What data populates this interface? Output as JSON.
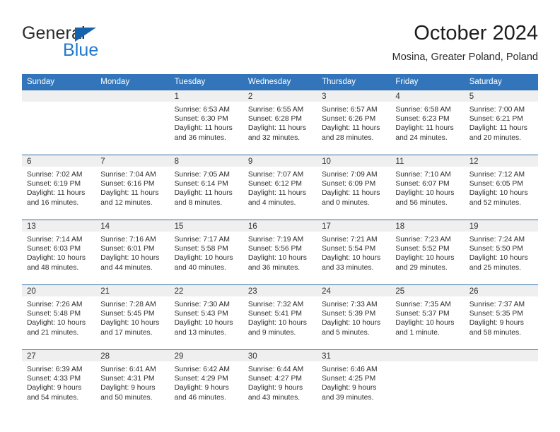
{
  "brand": {
    "name_part1": "General",
    "name_part2": "Blue",
    "accent_color": "#2079cf",
    "triangle_color": "#1463ac"
  },
  "header": {
    "title": "October 2024",
    "subtitle": "Mosina, Greater Poland, Poland",
    "header_bg_color": "#3275ba",
    "row_divider_color": "#2c6ba8",
    "daybar_bg_color": "#efefef"
  },
  "weekday_headers": [
    "Sunday",
    "Monday",
    "Tuesday",
    "Wednesday",
    "Thursday",
    "Friday",
    "Saturday"
  ],
  "weeks": [
    [
      {
        "day": "",
        "empty": true,
        "sunrise": "",
        "sunset": "",
        "daylight_l1": "",
        "daylight_l2": ""
      },
      {
        "day": "",
        "empty": true,
        "sunrise": "",
        "sunset": "",
        "daylight_l1": "",
        "daylight_l2": ""
      },
      {
        "day": "1",
        "empty": false,
        "sunrise": "Sunrise: 6:53 AM",
        "sunset": "Sunset: 6:30 PM",
        "daylight_l1": "Daylight: 11 hours",
        "daylight_l2": "and 36 minutes."
      },
      {
        "day": "2",
        "empty": false,
        "sunrise": "Sunrise: 6:55 AM",
        "sunset": "Sunset: 6:28 PM",
        "daylight_l1": "Daylight: 11 hours",
        "daylight_l2": "and 32 minutes."
      },
      {
        "day": "3",
        "empty": false,
        "sunrise": "Sunrise: 6:57 AM",
        "sunset": "Sunset: 6:26 PM",
        "daylight_l1": "Daylight: 11 hours",
        "daylight_l2": "and 28 minutes."
      },
      {
        "day": "4",
        "empty": false,
        "sunrise": "Sunrise: 6:58 AM",
        "sunset": "Sunset: 6:23 PM",
        "daylight_l1": "Daylight: 11 hours",
        "daylight_l2": "and 24 minutes."
      },
      {
        "day": "5",
        "empty": false,
        "sunrise": "Sunrise: 7:00 AM",
        "sunset": "Sunset: 6:21 PM",
        "daylight_l1": "Daylight: 11 hours",
        "daylight_l2": "and 20 minutes."
      }
    ],
    [
      {
        "day": "6",
        "empty": false,
        "sunrise": "Sunrise: 7:02 AM",
        "sunset": "Sunset: 6:19 PM",
        "daylight_l1": "Daylight: 11 hours",
        "daylight_l2": "and 16 minutes."
      },
      {
        "day": "7",
        "empty": false,
        "sunrise": "Sunrise: 7:04 AM",
        "sunset": "Sunset: 6:16 PM",
        "daylight_l1": "Daylight: 11 hours",
        "daylight_l2": "and 12 minutes."
      },
      {
        "day": "8",
        "empty": false,
        "sunrise": "Sunrise: 7:05 AM",
        "sunset": "Sunset: 6:14 PM",
        "daylight_l1": "Daylight: 11 hours",
        "daylight_l2": "and 8 minutes."
      },
      {
        "day": "9",
        "empty": false,
        "sunrise": "Sunrise: 7:07 AM",
        "sunset": "Sunset: 6:12 PM",
        "daylight_l1": "Daylight: 11 hours",
        "daylight_l2": "and 4 minutes."
      },
      {
        "day": "10",
        "empty": false,
        "sunrise": "Sunrise: 7:09 AM",
        "sunset": "Sunset: 6:09 PM",
        "daylight_l1": "Daylight: 11 hours",
        "daylight_l2": "and 0 minutes."
      },
      {
        "day": "11",
        "empty": false,
        "sunrise": "Sunrise: 7:10 AM",
        "sunset": "Sunset: 6:07 PM",
        "daylight_l1": "Daylight: 10 hours",
        "daylight_l2": "and 56 minutes."
      },
      {
        "day": "12",
        "empty": false,
        "sunrise": "Sunrise: 7:12 AM",
        "sunset": "Sunset: 6:05 PM",
        "daylight_l1": "Daylight: 10 hours",
        "daylight_l2": "and 52 minutes."
      }
    ],
    [
      {
        "day": "13",
        "empty": false,
        "sunrise": "Sunrise: 7:14 AM",
        "sunset": "Sunset: 6:03 PM",
        "daylight_l1": "Daylight: 10 hours",
        "daylight_l2": "and 48 minutes."
      },
      {
        "day": "14",
        "empty": false,
        "sunrise": "Sunrise: 7:16 AM",
        "sunset": "Sunset: 6:01 PM",
        "daylight_l1": "Daylight: 10 hours",
        "daylight_l2": "and 44 minutes."
      },
      {
        "day": "15",
        "empty": false,
        "sunrise": "Sunrise: 7:17 AM",
        "sunset": "Sunset: 5:58 PM",
        "daylight_l1": "Daylight: 10 hours",
        "daylight_l2": "and 40 minutes."
      },
      {
        "day": "16",
        "empty": false,
        "sunrise": "Sunrise: 7:19 AM",
        "sunset": "Sunset: 5:56 PM",
        "daylight_l1": "Daylight: 10 hours",
        "daylight_l2": "and 36 minutes."
      },
      {
        "day": "17",
        "empty": false,
        "sunrise": "Sunrise: 7:21 AM",
        "sunset": "Sunset: 5:54 PM",
        "daylight_l1": "Daylight: 10 hours",
        "daylight_l2": "and 33 minutes."
      },
      {
        "day": "18",
        "empty": false,
        "sunrise": "Sunrise: 7:23 AM",
        "sunset": "Sunset: 5:52 PM",
        "daylight_l1": "Daylight: 10 hours",
        "daylight_l2": "and 29 minutes."
      },
      {
        "day": "19",
        "empty": false,
        "sunrise": "Sunrise: 7:24 AM",
        "sunset": "Sunset: 5:50 PM",
        "daylight_l1": "Daylight: 10 hours",
        "daylight_l2": "and 25 minutes."
      }
    ],
    [
      {
        "day": "20",
        "empty": false,
        "sunrise": "Sunrise: 7:26 AM",
        "sunset": "Sunset: 5:48 PM",
        "daylight_l1": "Daylight: 10 hours",
        "daylight_l2": "and 21 minutes."
      },
      {
        "day": "21",
        "empty": false,
        "sunrise": "Sunrise: 7:28 AM",
        "sunset": "Sunset: 5:45 PM",
        "daylight_l1": "Daylight: 10 hours",
        "daylight_l2": "and 17 minutes."
      },
      {
        "day": "22",
        "empty": false,
        "sunrise": "Sunrise: 7:30 AM",
        "sunset": "Sunset: 5:43 PM",
        "daylight_l1": "Daylight: 10 hours",
        "daylight_l2": "and 13 minutes."
      },
      {
        "day": "23",
        "empty": false,
        "sunrise": "Sunrise: 7:32 AM",
        "sunset": "Sunset: 5:41 PM",
        "daylight_l1": "Daylight: 10 hours",
        "daylight_l2": "and 9 minutes."
      },
      {
        "day": "24",
        "empty": false,
        "sunrise": "Sunrise: 7:33 AM",
        "sunset": "Sunset: 5:39 PM",
        "daylight_l1": "Daylight: 10 hours",
        "daylight_l2": "and 5 minutes."
      },
      {
        "day": "25",
        "empty": false,
        "sunrise": "Sunrise: 7:35 AM",
        "sunset": "Sunset: 5:37 PM",
        "daylight_l1": "Daylight: 10 hours",
        "daylight_l2": "and 1 minute."
      },
      {
        "day": "26",
        "empty": false,
        "sunrise": "Sunrise: 7:37 AM",
        "sunset": "Sunset: 5:35 PM",
        "daylight_l1": "Daylight: 9 hours",
        "daylight_l2": "and 58 minutes."
      }
    ],
    [
      {
        "day": "27",
        "empty": false,
        "sunrise": "Sunrise: 6:39 AM",
        "sunset": "Sunset: 4:33 PM",
        "daylight_l1": "Daylight: 9 hours",
        "daylight_l2": "and 54 minutes."
      },
      {
        "day": "28",
        "empty": false,
        "sunrise": "Sunrise: 6:41 AM",
        "sunset": "Sunset: 4:31 PM",
        "daylight_l1": "Daylight: 9 hours",
        "daylight_l2": "and 50 minutes."
      },
      {
        "day": "29",
        "empty": false,
        "sunrise": "Sunrise: 6:42 AM",
        "sunset": "Sunset: 4:29 PM",
        "daylight_l1": "Daylight: 9 hours",
        "daylight_l2": "and 46 minutes."
      },
      {
        "day": "30",
        "empty": false,
        "sunrise": "Sunrise: 6:44 AM",
        "sunset": "Sunset: 4:27 PM",
        "daylight_l1": "Daylight: 9 hours",
        "daylight_l2": "and 43 minutes."
      },
      {
        "day": "31",
        "empty": false,
        "sunrise": "Sunrise: 6:46 AM",
        "sunset": "Sunset: 4:25 PM",
        "daylight_l1": "Daylight: 9 hours",
        "daylight_l2": "and 39 minutes."
      },
      {
        "day": "",
        "empty": true,
        "sunrise": "",
        "sunset": "",
        "daylight_l1": "",
        "daylight_l2": ""
      },
      {
        "day": "",
        "empty": true,
        "sunrise": "",
        "sunset": "",
        "daylight_l1": "",
        "daylight_l2": ""
      }
    ]
  ]
}
